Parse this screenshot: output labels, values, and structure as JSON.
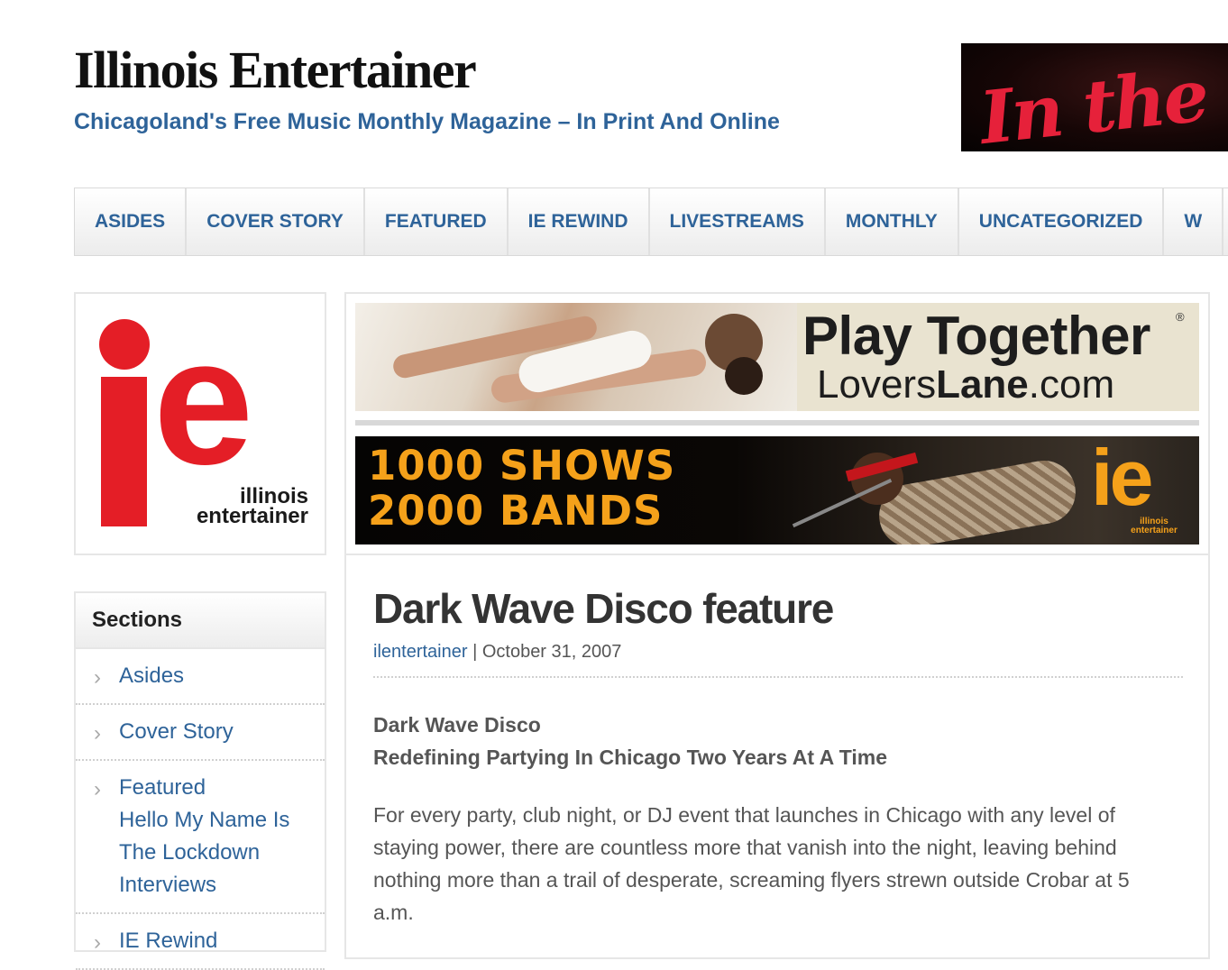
{
  "header": {
    "site_title": "Illinois Entertainer",
    "tagline": "Chicagoland's Free Music Monthly Magazine – In Print And Online",
    "ad_text": "In the Flesh"
  },
  "nav": {
    "items": [
      "ASIDES",
      "COVER STORY",
      "FEATURED",
      "IE REWIND",
      "LIVESTREAMS",
      "MONTHLY",
      "UNCATEGORIZED",
      "W"
    ]
  },
  "logo": {
    "letters": "ie",
    "line1": "illinois",
    "line2": "entertainer"
  },
  "sidebar": {
    "heading": "Sections",
    "items": [
      {
        "label": "Asides"
      },
      {
        "label": "Cover Story"
      },
      {
        "label": "Featured",
        "sub": [
          "Hello My Name Is",
          "The Lockdown",
          "Interviews"
        ]
      },
      {
        "label": "IE Rewind"
      }
    ]
  },
  "ads": {
    "ad1_headline": "Play Together",
    "ad1_sub_light": "Lovers",
    "ad1_sub_bold": "Lane",
    "ad1_sub_end": ".com",
    "ad1_reg": "®",
    "ad2_line1": "1000 SHOWS",
    "ad2_line2": "2000 BANDS",
    "ad2_logo": "ie",
    "ad2_logo_line1": "illinois",
    "ad2_logo_line2": "entertainer"
  },
  "post": {
    "title": "Dark Wave Disco feature",
    "author": "ilentertainer",
    "separator": " | ",
    "date": "October 31, 2007",
    "subheading1": "Dark Wave Disco",
    "subheading2": "Redefining Partying In Chicago Two Years At A Time",
    "body": "For every party, club night, or DJ event that launches in Chicago with any level of staying power, there are countless more that vanish into the night, leaving behind nothing more than a trail of desperate, screaming flyers strewn outside Crobar at 5 a.m."
  },
  "colors": {
    "link": "#2e6399",
    "brand_red": "#e41e26",
    "ad_orange": "#f5a11a"
  }
}
